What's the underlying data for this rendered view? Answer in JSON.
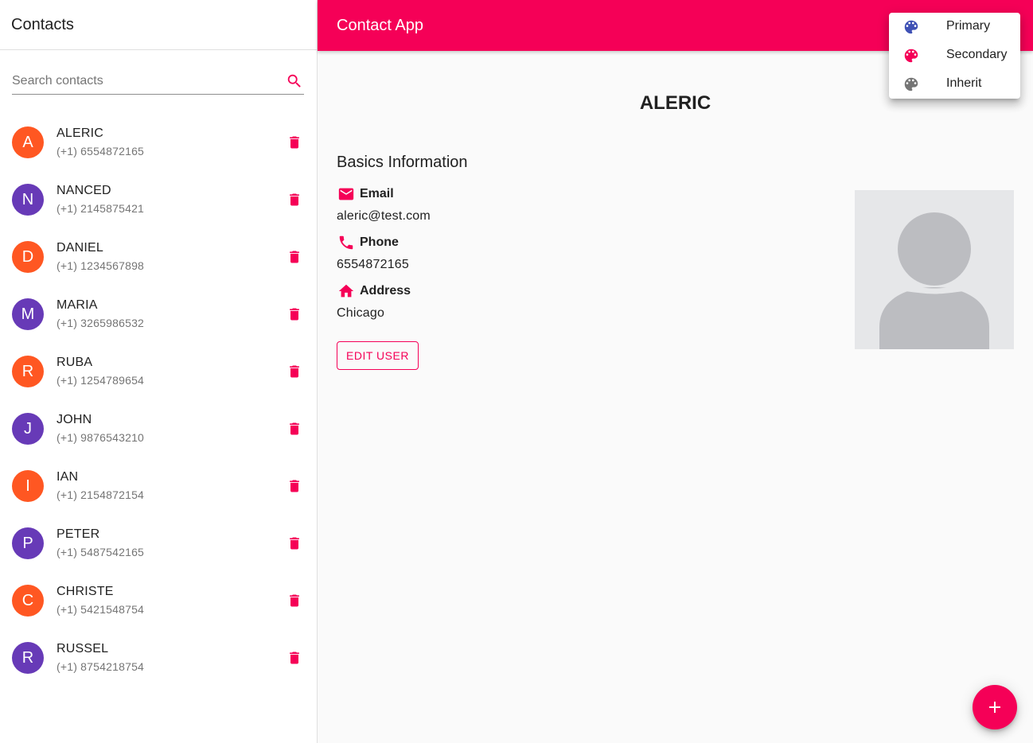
{
  "sidebar": {
    "title": "Contacts",
    "search": {
      "placeholder": "Search contacts",
      "value": ""
    },
    "contacts": [
      {
        "initial": "A",
        "name": "ALERIC",
        "phone": "(+1) 6554872165",
        "color": "#ff5722"
      },
      {
        "initial": "N",
        "name": "NANCED",
        "phone": "(+1) 2145875421",
        "color": "#673ab7"
      },
      {
        "initial": "D",
        "name": "DANIEL",
        "phone": "(+1) 1234567898",
        "color": "#ff5722"
      },
      {
        "initial": "M",
        "name": "MARIA",
        "phone": "(+1) 3265986532",
        "color": "#673ab7"
      },
      {
        "initial": "R",
        "name": "RUBA",
        "phone": "(+1) 1254789654",
        "color": "#ff5722"
      },
      {
        "initial": "J",
        "name": "JOHN",
        "phone": "(+1) 9876543210",
        "color": "#673ab7"
      },
      {
        "initial": "I",
        "name": "IAN",
        "phone": "(+1) 2154872154",
        "color": "#ff5722"
      },
      {
        "initial": "P",
        "name": "PETER",
        "phone": "(+1) 5487542165",
        "color": "#673ab7"
      },
      {
        "initial": "C",
        "name": "CHRISTE",
        "phone": "(+1) 5421548754",
        "color": "#ff5722"
      },
      {
        "initial": "R",
        "name": "RUSSEL",
        "phone": "(+1) 8754218754",
        "color": "#673ab7"
      }
    ]
  },
  "appbar": {
    "title": "Contact App",
    "color": "#f50057"
  },
  "detail": {
    "name": "ALERIC",
    "section_title": "Basics Information",
    "email_label": "Email",
    "email": "aleric@test.com",
    "phone_label": "Phone",
    "phone": "6554872165",
    "address_label": "Address",
    "address": "Chicago",
    "edit_label": "EDIT USER"
  },
  "menu": {
    "items": [
      {
        "label": "Primary",
        "icon": "palette-icon",
        "color": "#3f51b5"
      },
      {
        "label": "Secondary",
        "icon": "palette-icon",
        "color": "#f50057"
      },
      {
        "label": "Inherit",
        "icon": "palette-icon",
        "color": "#757575"
      }
    ]
  },
  "colors": {
    "accent": "#f50057",
    "orange": "#ff5722",
    "purple": "#673ab7"
  }
}
